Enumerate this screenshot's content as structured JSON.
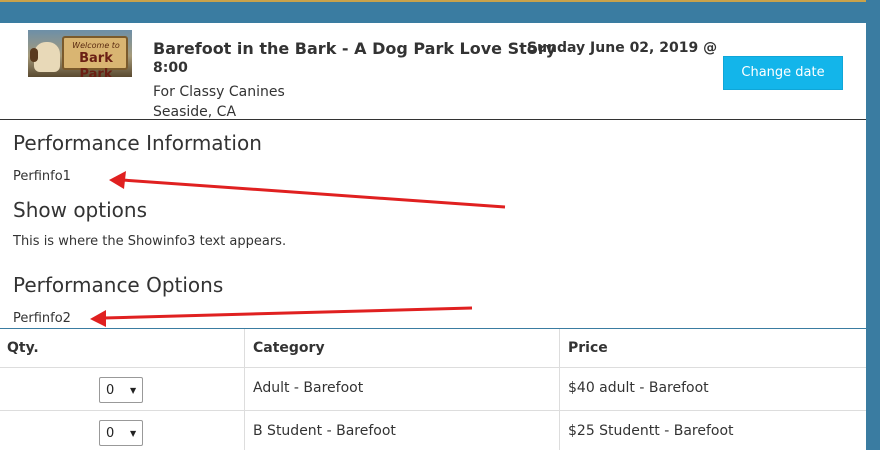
{
  "event": {
    "logo_sign_line1": "Welcome to",
    "logo_sign_line2": "Bark Park",
    "title": "Barefoot in the Bark - A Dog Park Love Story",
    "date": "Sunday June 02, 2019 @",
    "time": "8:00",
    "subtitle": "For Classy Canines",
    "location": "Seaside, CA",
    "change_date_label": "Change date"
  },
  "sections": {
    "performance_info_heading": "Performance Information",
    "performance_info_text": "Perfinfo1",
    "show_options_heading": "Show options",
    "show_options_text": "This is where the Showinfo3 text appears.",
    "performance_options_heading": "Performance Options",
    "performance_options_text": "Perfinfo2"
  },
  "table": {
    "headers": [
      "Qty.",
      "Category",
      "Price"
    ],
    "rows": [
      {
        "qty": "0",
        "category": "Adult - Barefoot",
        "price": "$40 adult - Barefoot"
      },
      {
        "qty": "0",
        "category": "B Student - Barefoot",
        "price": "$25 Studentt - Barefoot"
      }
    ]
  },
  "colors": {
    "frame": "#3a7ca1",
    "button": "#13b5ea",
    "annotation_arrow": "#e02020"
  }
}
